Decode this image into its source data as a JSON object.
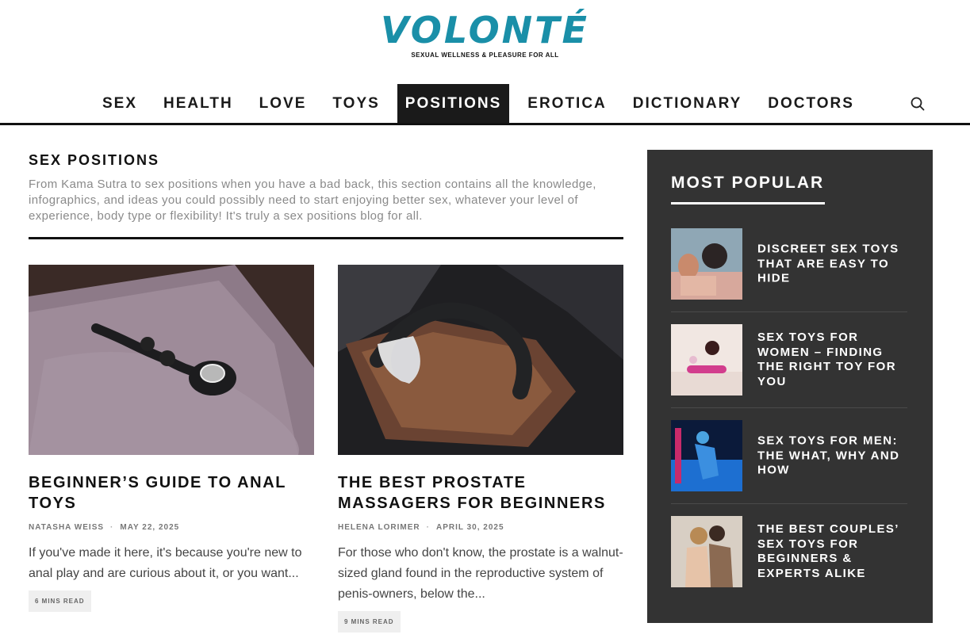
{
  "brand": {
    "logo": "VOLONTÉ",
    "tagline": "SEXUAL WELLNESS & PLEASURE FOR ALL"
  },
  "nav": {
    "items": [
      "SEX",
      "HEALTH",
      "LOVE",
      "TOYS",
      "POSITIONS",
      "EROTICA",
      "DICTIONARY",
      "DOCTORS"
    ],
    "active": "POSITIONS",
    "search_icon": "search-icon"
  },
  "section": {
    "title": "SEX POSITIONS",
    "description": "From Kama Sutra to sex positions when you have a bad back, this section contains all the knowledge, infographics, and ideas you could possibly need to start enjoying better sex, whatever your level of experience, body type or flexibility! It's truly a sex positions blog for all."
  },
  "articles": [
    {
      "title": "BEGINNER’S GUIDE TO ANAL TOYS",
      "author": "NATASHA WEISS",
      "date": "MAY 22, 2025",
      "excerpt": "If you've made it here, it's because you're new to anal play and are curious about it, or you want...",
      "read_time": "6 MINS READ"
    },
    {
      "title": "THE BEST PROSTATE MASSAGERS FOR BEGINNERS",
      "author": "HELENA LORIMER",
      "date": "APRIL 30, 2025",
      "excerpt": "For those who don't know, the prostate is a walnut-sized gland found in the reproductive system of penis-owners, below the...",
      "read_time": "9 MINS READ"
    }
  ],
  "sidebar": {
    "title": "MOST POPULAR",
    "items": [
      {
        "title": "DISCREET SEX TOYS THAT ARE EASY TO HIDE"
      },
      {
        "title": "SEX TOYS FOR WOMEN – FINDING THE RIGHT TOY FOR YOU"
      },
      {
        "title": "SEX TOYS FOR MEN: THE WHAT, WHY AND HOW"
      },
      {
        "title": "THE BEST COUPLES’ SEX TOYS FOR BEGINNERS & EXPERTS ALIKE"
      }
    ]
  },
  "colors": {
    "brand": "#1a8fa8",
    "nav_active_bg": "#1a1a1a",
    "sidebar_bg": "#333333",
    "text_muted": "#8a8a8a"
  }
}
